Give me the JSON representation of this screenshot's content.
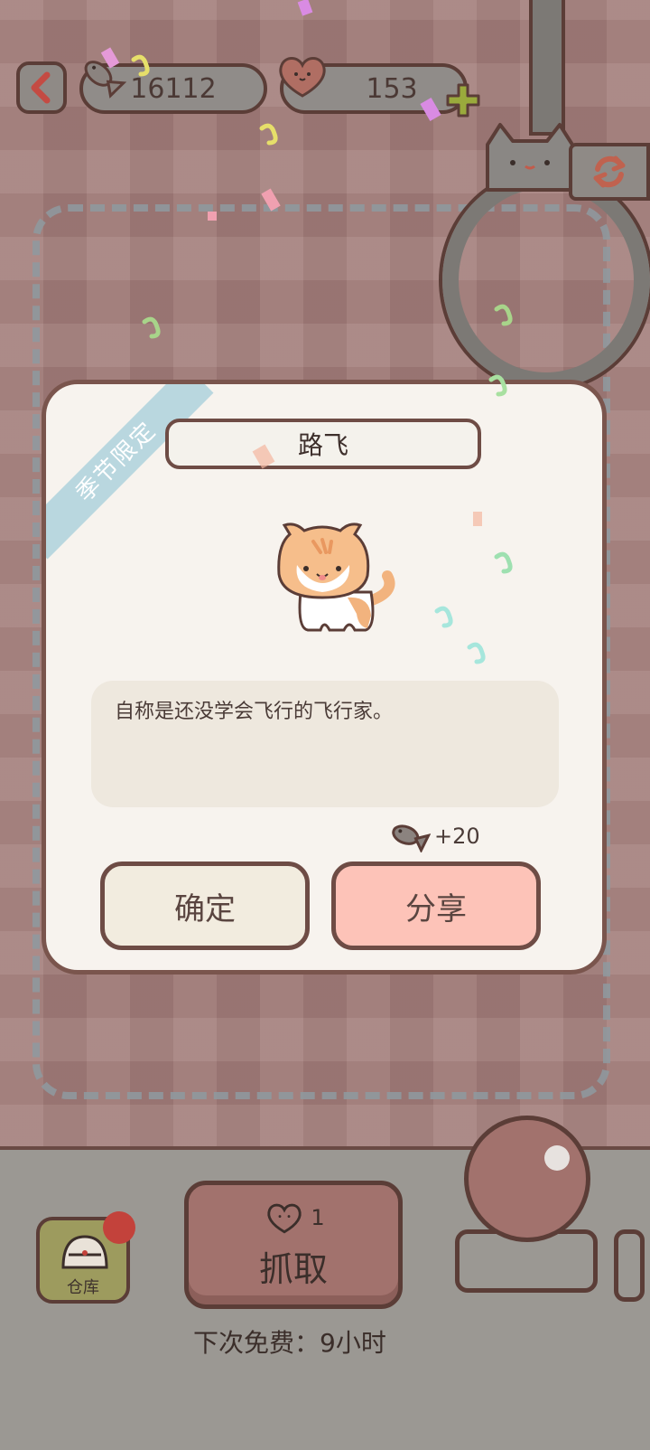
{
  "top_bar": {
    "fish_count": "16112",
    "heart_count": "153"
  },
  "dialog": {
    "ribbon": "季节限定",
    "cat_name": "路飞",
    "description": "自称是还没学会飞行的飞行家。",
    "reward": "+20",
    "confirm_label": "确定",
    "share_label": "分享"
  },
  "bottom": {
    "storage_label": "仓库",
    "grab_cost": "1",
    "grab_label": "抓取",
    "free_prefix": "下次免费：",
    "free_value": "9小时"
  },
  "colors": {
    "background": "#a27c79",
    "accent_share": "#fdc3b8",
    "border": "#6e4c45"
  }
}
